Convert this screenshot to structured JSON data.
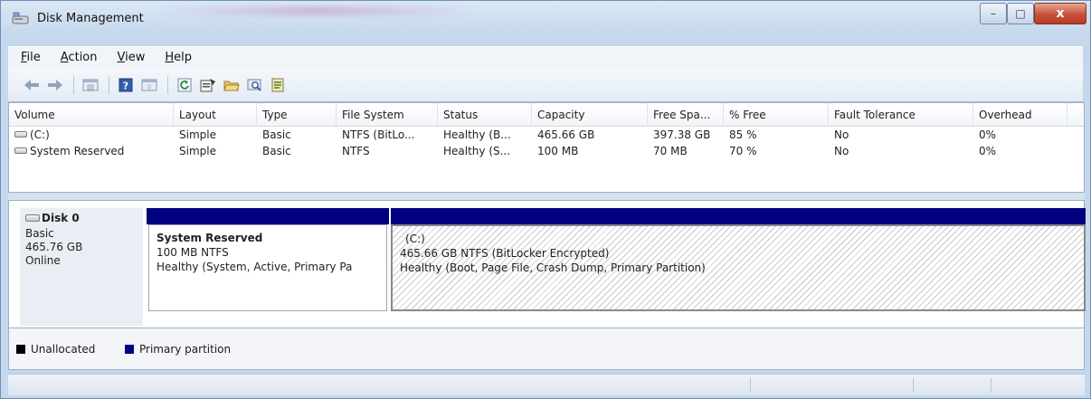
{
  "window": {
    "title": "Disk Management",
    "controls": {
      "minimize": "–",
      "maximize": "□",
      "close": "x"
    }
  },
  "menubar": {
    "items": [
      {
        "label": "File",
        "mnemonic": "F"
      },
      {
        "label": "Action",
        "mnemonic": "A"
      },
      {
        "label": "View",
        "mnemonic": "V"
      },
      {
        "label": "Help",
        "mnemonic": "H"
      }
    ]
  },
  "toolbar": {
    "buttons": [
      "back-arrow-icon",
      "forward-arrow-icon",
      "console-tree-icon",
      "help-icon",
      "show-pane-icon",
      "refresh-icon",
      "properties-icon",
      "open-folder-icon",
      "find-icon",
      "export-list-icon"
    ]
  },
  "volumes": {
    "columns": [
      "Volume",
      "Layout",
      "Type",
      "File System",
      "Status",
      "Capacity",
      "Free Spa...",
      "% Free",
      "Fault Tolerance",
      "Overhead"
    ],
    "rows": [
      {
        "volume": "(C:)",
        "layout": "Simple",
        "type": "Basic",
        "file_system": "NTFS (BitLo...",
        "status": "Healthy (B...",
        "capacity": "465.66 GB",
        "free_space": "397.38 GB",
        "percent_free": "85 %",
        "fault_tolerance": "No",
        "overhead": "0%"
      },
      {
        "volume": "System Reserved",
        "layout": "Simple",
        "type": "Basic",
        "file_system": "NTFS",
        "status": "Healthy (S...",
        "capacity": "100 MB",
        "free_space": "70 MB",
        "percent_free": "70 %",
        "fault_tolerance": "No",
        "overhead": "0%"
      }
    ]
  },
  "disk": {
    "name": "Disk 0",
    "type": "Basic",
    "size": "465.76 GB",
    "state": "Online",
    "partitions": [
      {
        "title": "System Reserved",
        "line1": "100 MB NTFS",
        "line2": "Healthy (System, Active, Primary Pa"
      },
      {
        "title": "(C:)",
        "line1": "465.66 GB NTFS (BitLocker Encrypted)",
        "line2": "Healthy (Boot, Page File, Crash Dump, Primary Partition)"
      }
    ]
  },
  "legend": {
    "items": [
      {
        "label": "Unallocated",
        "color": "#000000"
      },
      {
        "label": "Primary partition",
        "color": "#000080"
      }
    ]
  },
  "colors": {
    "primary_partition": "#000080",
    "unallocated": "#000000",
    "close_button": "#c7523b"
  }
}
